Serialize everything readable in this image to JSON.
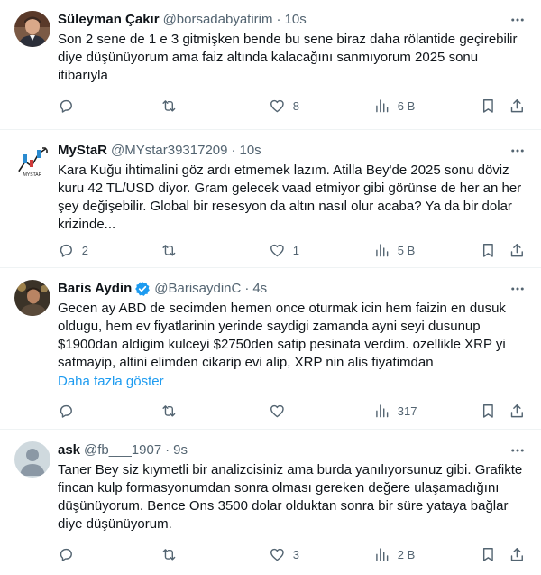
{
  "tweets": [
    {
      "name": "Süleyman Çakır",
      "handle": "@borsadabyatirim",
      "separator": "·",
      "time": "10s",
      "text": "Son 2 sene de 1 e 3 gitmişken bende bu sene biraz daha rölantide geçirebilir diye düşünüyorum ama faiz altında kalacağını sanmıyorum 2025 sonu itibarıyla",
      "replies": "",
      "retweets": "",
      "likes": "8",
      "views": "6 B",
      "avatar_icon": "profile-photo"
    },
    {
      "name": "MyStaR",
      "handle": "@MYstar39317209",
      "separator": "·",
      "time": "10s",
      "text": "Kara Kuğu ihtimalini göz ardı etmemek lazım. Atilla Bey'de 2025 sonu döviz kuru 42 TL/USD diyor. Gram gelecek vaad etmiyor gibi görünse de her an her şey değişebilir. Global bir resesyon da altın nasıl olur acaba? Ya da bir dolar krizinde...",
      "replies": "2",
      "retweets": "",
      "likes": "1",
      "views": "5 B",
      "avatar_icon": "chart-logo"
    },
    {
      "name": "Baris Aydin",
      "handle": "@BarisaydinC",
      "separator": "·",
      "time": "4s",
      "text": "Gecen ay ABD de secimden hemen once oturmak icin hem faizin en dusuk oldugu, hem ev fiyatlarinin yerinde saydigi zamanda ayni seyi dusunup $1900dan aldigim kulceyi $2750den satip pesinata verdim. ozellikle XRP yi satmayip, altini elimden cikarip evi alip, XRP nin alis fiyatimdan",
      "show_more": "Daha fazla göster",
      "replies": "",
      "retweets": "",
      "likes": "",
      "views": "317",
      "avatar_icon": "profile-photo",
      "verified": true
    },
    {
      "name": "ask",
      "handle": "@fb___1907",
      "separator": "·",
      "time": "9s",
      "text": "Taner Bey siz kıymetli bir analizcisiniz ama burda yanılıyorsunuz gibi. Grafikte fincan kulp formasyonumdan sonra olması gereken değere ulaşamadığını düşünüyorum. Bence Ons 3500 dolar olduktan sonra bir süre yataya bağlar diye düşünüyorum.",
      "replies": "",
      "retweets": "",
      "likes": "3",
      "views": "2 B",
      "avatar_icon": "default-avatar"
    }
  ],
  "colors": {
    "text": "#0f1419",
    "secondary": "#536471",
    "link": "#1d9bf0",
    "divider": "#eff3f4",
    "verified": "#1d9bf0"
  }
}
